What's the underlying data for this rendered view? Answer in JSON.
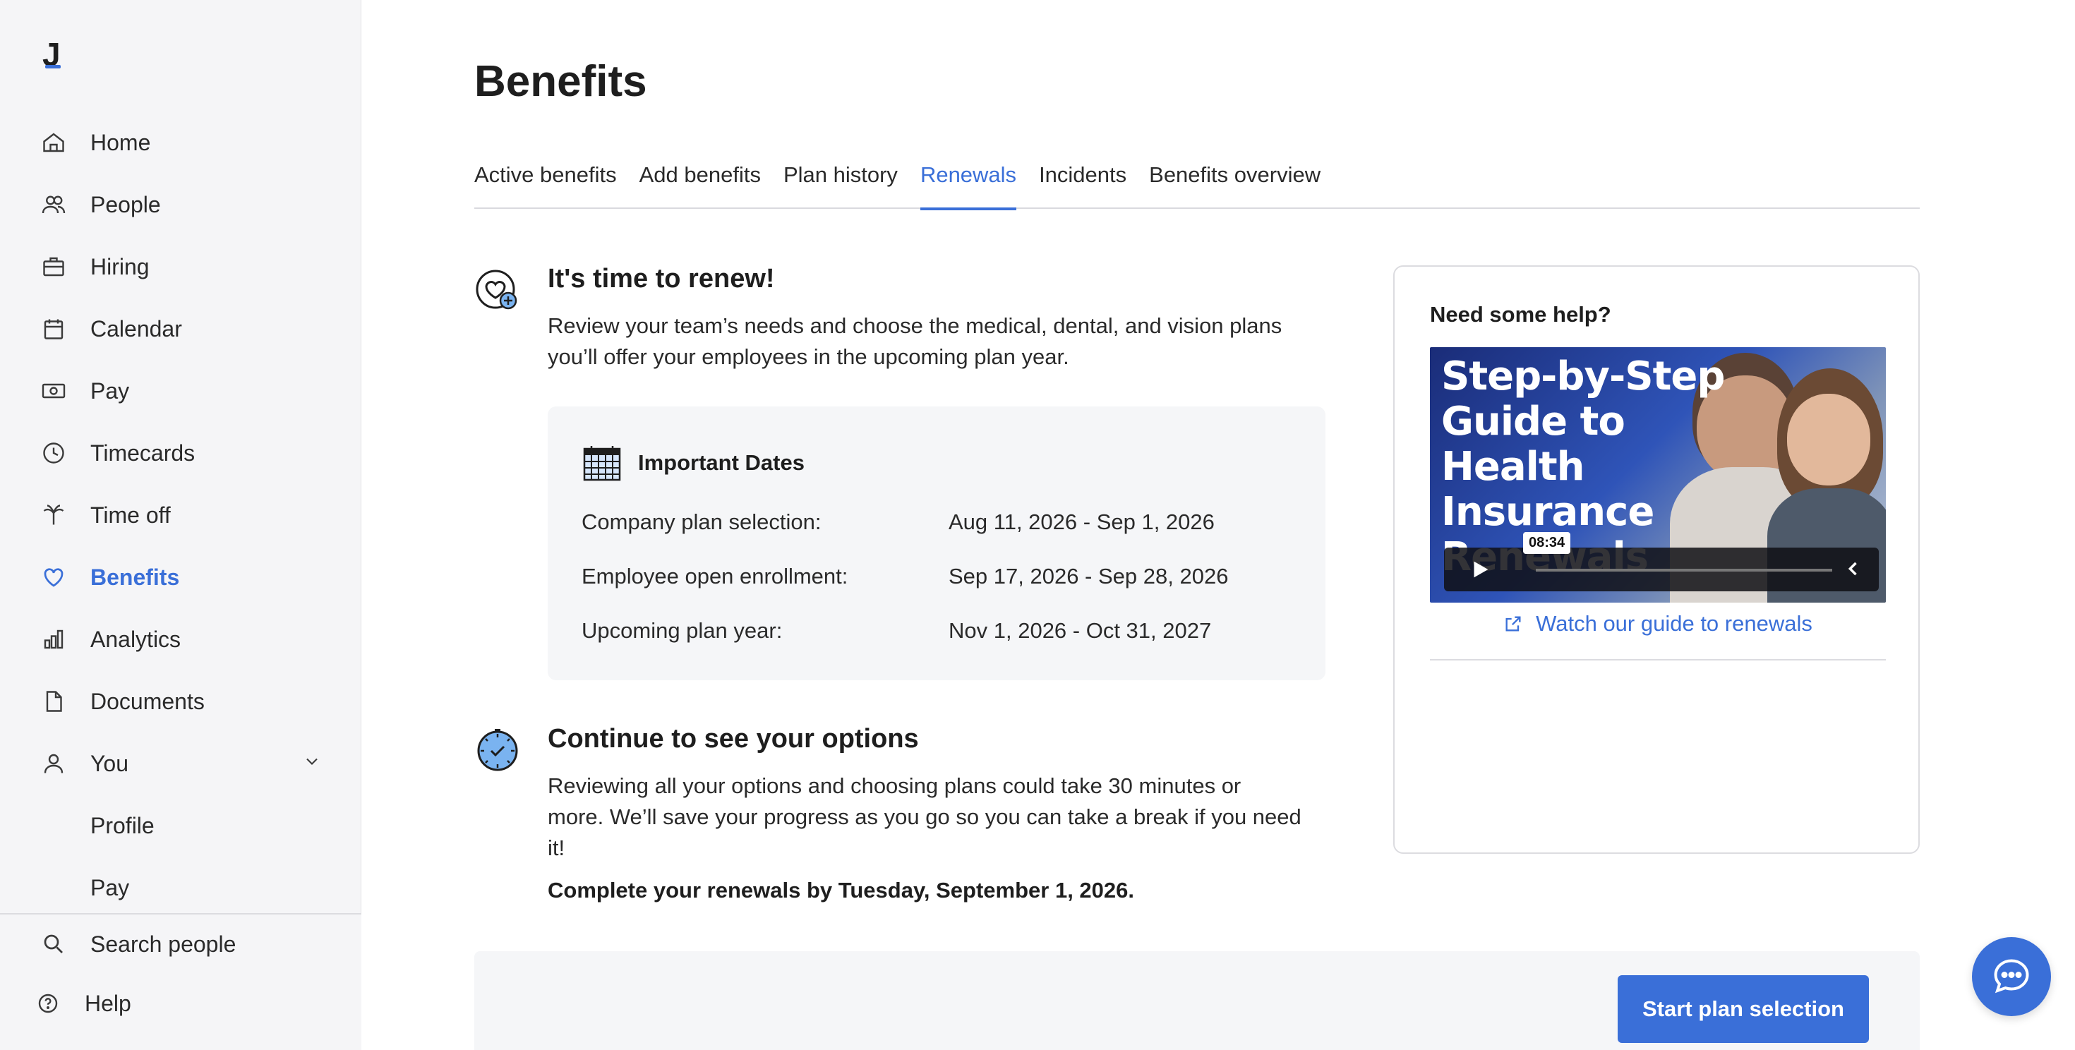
{
  "app": {
    "logo": "J"
  },
  "sidebar": {
    "items": [
      {
        "label": "Home",
        "icon": "home-icon"
      },
      {
        "label": "People",
        "icon": "people-icon"
      },
      {
        "label": "Hiring",
        "icon": "briefcase-icon"
      },
      {
        "label": "Calendar",
        "icon": "calendar-icon"
      },
      {
        "label": "Pay",
        "icon": "money-icon"
      },
      {
        "label": "Timecards",
        "icon": "clock-icon"
      },
      {
        "label": "Time off",
        "icon": "palm-tree-icon"
      },
      {
        "label": "Benefits",
        "icon": "heart-icon",
        "active": true
      },
      {
        "label": "Analytics",
        "icon": "bar-chart-icon"
      },
      {
        "label": "Documents",
        "icon": "document-icon"
      },
      {
        "label": "You",
        "icon": "user-icon",
        "expanded": true
      }
    ],
    "sub_items": [
      "Profile",
      "Pay"
    ],
    "bottom": [
      {
        "label": "Search people",
        "icon": "search-icon"
      },
      {
        "label": "Help",
        "icon": "help-icon"
      }
    ]
  },
  "main": {
    "title": "Benefits",
    "tabs": [
      {
        "label": "Active benefits"
      },
      {
        "label": "Add benefits"
      },
      {
        "label": "Plan history"
      },
      {
        "label": "Renewals",
        "active": true
      },
      {
        "label": "Incidents"
      },
      {
        "label": "Benefits overview"
      }
    ],
    "renew": {
      "title": "It's time to renew!",
      "line1": "Review your team’s needs and choose the medical, dental, and vision plans",
      "line2": "you’ll offer your employees in the upcoming plan year."
    },
    "dates": {
      "title": "Important Dates",
      "rows": [
        {
          "label": "Company plan selection:",
          "value": "Aug 11, 2026 - Sep 1, 2026"
        },
        {
          "label": "Employee open enrollment:",
          "value": "Sep 17, 2026 - Sep 28, 2026"
        },
        {
          "label": "Upcoming plan year:",
          "value": "Nov 1, 2026 - Oct 31, 2027"
        }
      ]
    },
    "options": {
      "title": "Continue to see your options",
      "line1": "Reviewing all your options and choosing plans could take 30 minutes or",
      "line2": "more. We’ll save your progress as you go so you can take a break if you need",
      "line3": "it!",
      "deadline": "Complete your renewals by Tuesday, September 1, 2026."
    },
    "help": {
      "title": "Need some help?",
      "video_title_1": "Step-by-Step",
      "video_title_2": "Guide to",
      "video_title_3": "Health",
      "video_title_4": "Insurance",
      "video_title_5": "Renewals",
      "video_duration": "08:34",
      "link": "Watch our guide to renewals"
    },
    "cta": {
      "label": "Start plan selection"
    }
  },
  "colors": {
    "accent": "#3a6fd8",
    "sidebar_bg": "#f5f5f7",
    "card_bg": "#f5f6f8"
  }
}
